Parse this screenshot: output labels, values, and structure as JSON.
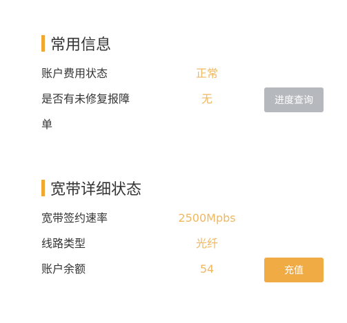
{
  "common_info": {
    "title": "常用信息",
    "rows": [
      {
        "label": "账户费用状态",
        "value": "正常"
      },
      {
        "label_line1": "是否有未修复报障",
        "label_line2": "单",
        "value": "无"
      }
    ],
    "progress_button": "进度查询"
  },
  "broadband": {
    "title": "宽带详细状态",
    "rows": [
      {
        "label": "宽带签约速率",
        "value": "2500Mpbs"
      },
      {
        "label": "线路类型",
        "value": "光纤"
      },
      {
        "label": "账户余额",
        "value": "54"
      }
    ],
    "recharge_button": "充值"
  },
  "colors": {
    "accent_bar": "#f0a833",
    "value_text": "#f0b75e",
    "button_gray": "#b5b9be",
    "button_orange": "#f0ab44"
  }
}
